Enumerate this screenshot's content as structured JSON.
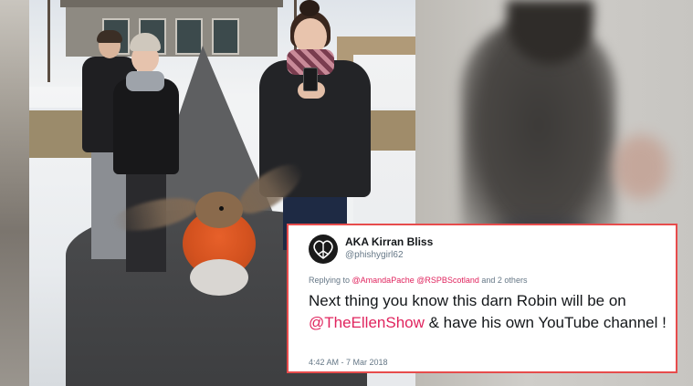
{
  "tweet": {
    "display_name": "AKA Kirran Bliss",
    "handle": "@phishygirl62",
    "reply_prefix": "Replying to ",
    "reply_mention_1": "@AmandaPache",
    "reply_mention_2": "@RSPBScotland",
    "reply_suffix": " and 2 others",
    "text_part_1": "Next thing you know this darn Robin will be on ",
    "text_mention": "@TheEllenShow",
    "text_part_2": "  & have his own YouTube channel !",
    "timestamp": "4:42 AM - 7 Mar 2018",
    "avatar_icon": "peace-heart-icon",
    "mention_color": "#e0245e",
    "border_color": "#e74c4c"
  },
  "photo": {
    "subject_icon": "robin-in-flight",
    "people_count": 3
  }
}
